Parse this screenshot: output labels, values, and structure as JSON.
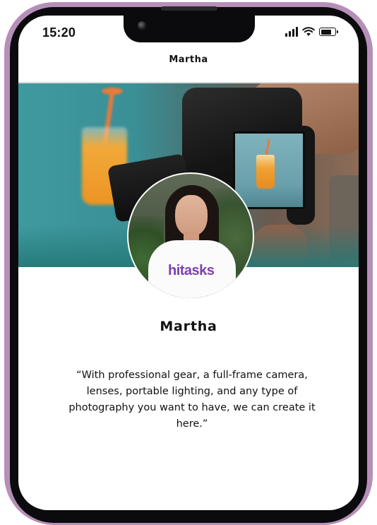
{
  "status_bar": {
    "time": "15:20",
    "icons": [
      "cellular-signal-icon",
      "wifi-icon",
      "battery-icon"
    ]
  },
  "header": {
    "title": "Martha"
  },
  "profile": {
    "name": "Martha",
    "avatar_logo_text": "hitasks",
    "quote": "“With professional gear, a full-frame camera, lenses, portable lighting, and any type of photography you want to have, we can create it here.”"
  },
  "colors": {
    "phone_frame": "#b68fb8",
    "logo_purple": "#7b3fb0",
    "cover_teal": "#3f9aa0"
  }
}
